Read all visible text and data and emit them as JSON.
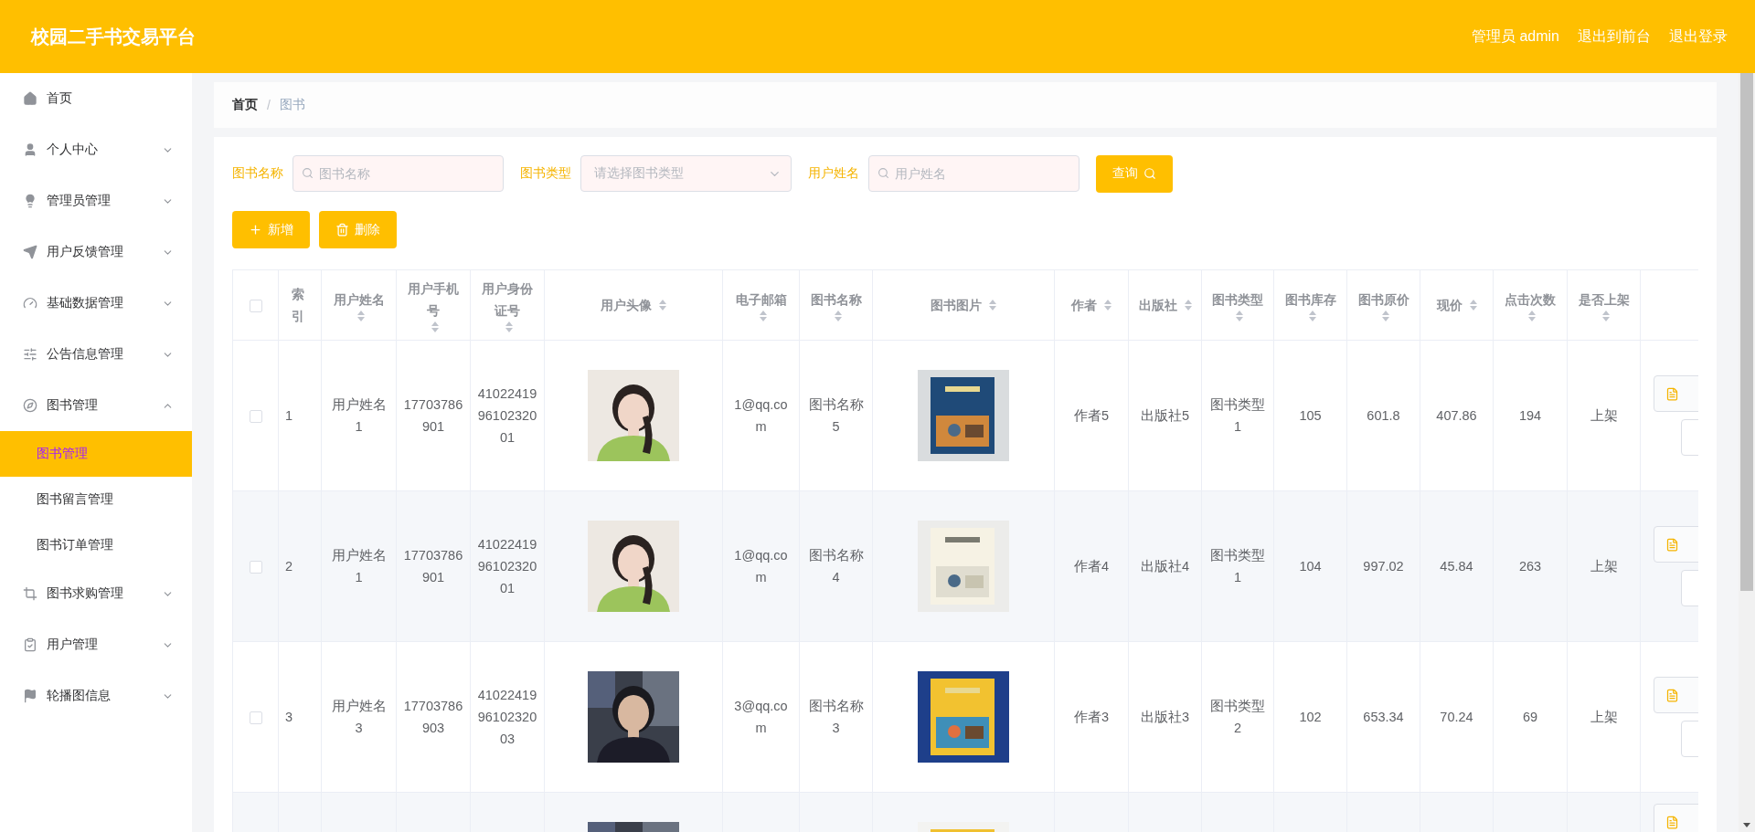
{
  "header": {
    "title": "校园二手书交易平台",
    "links": [
      "管理员 admin",
      "退出到前台",
      "退出登录"
    ]
  },
  "sidebar": {
    "items": [
      {
        "label": "首页"
      },
      {
        "label": "个人中心",
        "expanded": false
      },
      {
        "label": "管理员管理",
        "expanded": false
      },
      {
        "label": "用户反馈管理",
        "expanded": false
      },
      {
        "label": "基础数据管理",
        "expanded": false
      },
      {
        "label": "公告信息管理",
        "expanded": false
      },
      {
        "label": "图书管理",
        "expanded": true,
        "children": [
          {
            "label": "图书管理",
            "selected": true
          },
          {
            "label": "图书留言管理",
            "selected": false
          },
          {
            "label": "图书订单管理",
            "selected": false
          }
        ]
      },
      {
        "label": "图书求购管理",
        "expanded": false
      },
      {
        "label": "用户管理",
        "expanded": false
      },
      {
        "label": "轮播图信息",
        "expanded": false
      }
    ]
  },
  "breadcrumb": {
    "items": [
      "首页",
      "图书"
    ],
    "separator": "/"
  },
  "search": {
    "fields": [
      {
        "kind": "input",
        "label": "图书名称",
        "placeholder": "图书名称"
      },
      {
        "kind": "select",
        "label": "图书类型",
        "placeholder": "请选择图书类型"
      },
      {
        "kind": "input",
        "label": "用户姓名",
        "placeholder": "用户姓名"
      }
    ],
    "button": "查询"
  },
  "actions": [
    {
      "kind": "add",
      "label": "新增"
    },
    {
      "kind": "delete",
      "label": "删除"
    }
  ],
  "table": {
    "all_checked": false,
    "columns": [
      {
        "label": "索引",
        "sortable": false
      },
      {
        "label": "用户姓名",
        "sortable": true
      },
      {
        "label": "用户手机号",
        "sortable": true
      },
      {
        "label": "用户身份证号",
        "sortable": true
      },
      {
        "label": "用户头像",
        "sortable": true
      },
      {
        "label": "电子邮箱",
        "sortable": true
      },
      {
        "label": "图书名称",
        "sortable": true
      },
      {
        "label": "图书图片",
        "sortable": true
      },
      {
        "label": "作者",
        "sortable": true
      },
      {
        "label": "出版社",
        "sortable": true
      },
      {
        "label": "图书类型",
        "sortable": true
      },
      {
        "label": "图书库存",
        "sortable": true
      },
      {
        "label": "图书原价",
        "sortable": true
      },
      {
        "label": "现价",
        "sortable": true
      },
      {
        "label": "点击次数",
        "sortable": true
      },
      {
        "label": "是否上架",
        "sortable": true
      }
    ],
    "rows": [
      {
        "kind": "full",
        "checked": false,
        "cells": [
          "1",
          "用户姓名1",
          "17703786901",
          "410224199610232001",
          {
            "kind": "picture"
          },
          "1@qq.com",
          "图书名称5",
          {
            "kind": "picture"
          },
          "作者5",
          "出版社5",
          "图书类型1",
          "105",
          "601.8",
          "407.86",
          "194",
          "上架"
        ]
      },
      {
        "kind": "full",
        "checked": false,
        "cells": [
          "2",
          "用户姓名1",
          "17703786901",
          "410224199610232001",
          {
            "kind": "picture"
          },
          "1@qq.com",
          "图书名称4",
          {
            "kind": "picture"
          },
          "作者4",
          "出版社4",
          "图书类型1",
          "104",
          "997.02",
          "45.84",
          "263",
          "上架"
        ]
      },
      {
        "kind": "full",
        "checked": false,
        "cells": [
          "3",
          "用户姓名3",
          "17703786903",
          "410224199610232003",
          {
            "kind": "picture"
          },
          "3@qq.com",
          "图书名称3",
          {
            "kind": "picture"
          },
          "作者3",
          "出版社3",
          "图书类型2",
          "102",
          "653.34",
          "70.24",
          "69",
          "上架"
        ]
      },
      {
        "kind": "partial",
        "cells": [
          null,
          null,
          null,
          null,
          {
            "kind": "picture"
          },
          null,
          null,
          {
            "kind": "picture"
          },
          null,
          null,
          null,
          null,
          null,
          null,
          null,
          null
        ]
      }
    ]
  }
}
